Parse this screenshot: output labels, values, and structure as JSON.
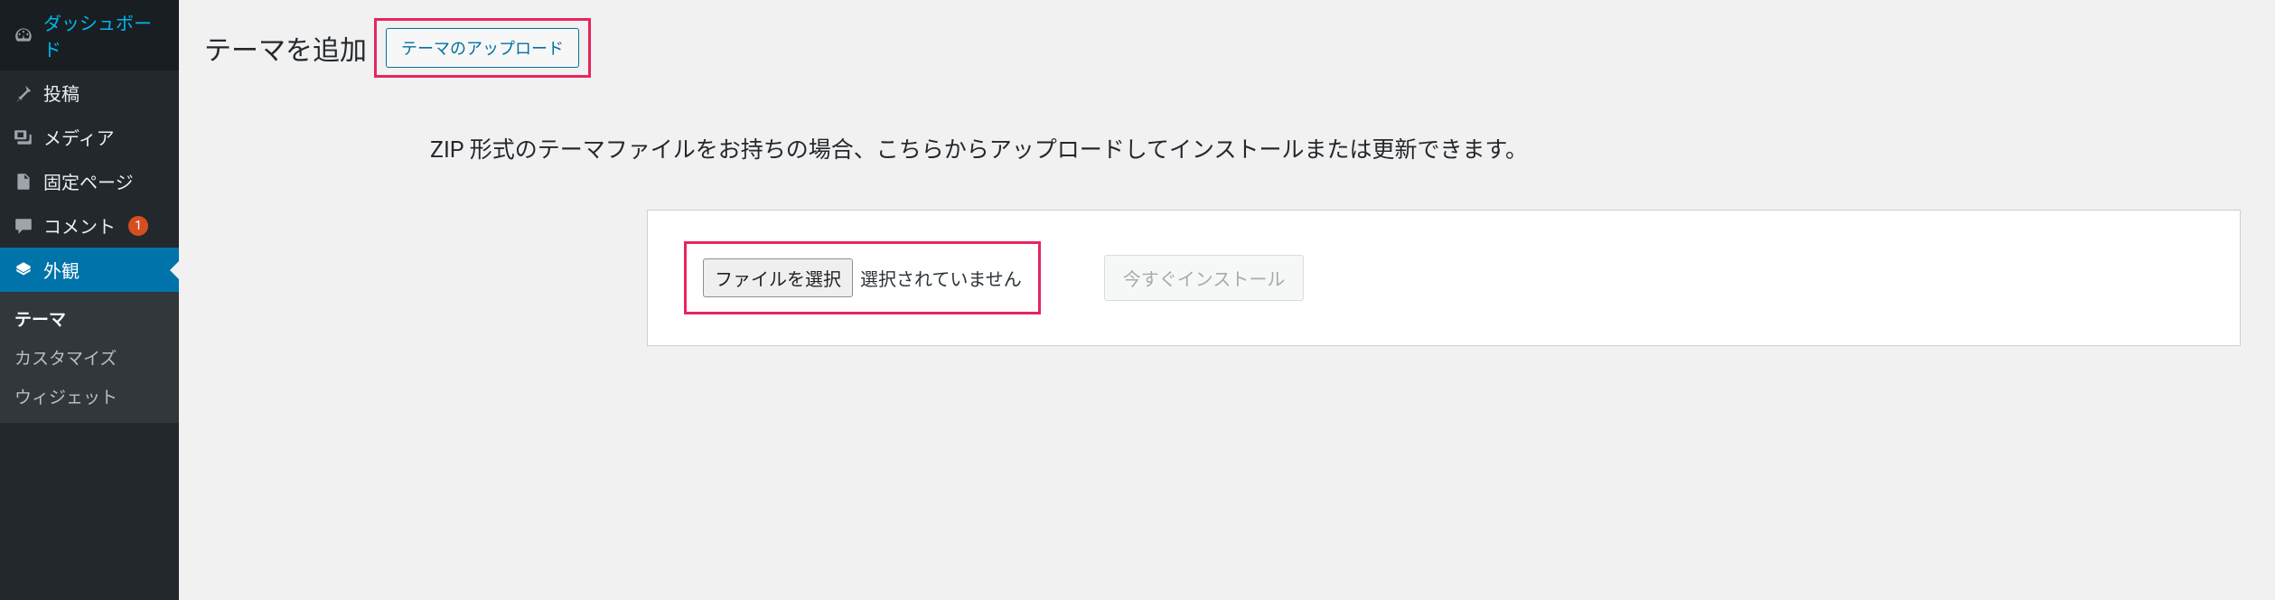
{
  "sidebar": {
    "items": [
      {
        "label": "ダッシュボード",
        "icon": "dashboard"
      },
      {
        "label": "投稿",
        "icon": "pin"
      },
      {
        "label": "メディア",
        "icon": "media"
      },
      {
        "label": "固定ページ",
        "icon": "page"
      },
      {
        "label": "コメント",
        "icon": "comment",
        "badge": "1"
      },
      {
        "label": "外観",
        "icon": "appearance",
        "active": true
      }
    ],
    "submenu": [
      {
        "label": "テーマ",
        "current": true
      },
      {
        "label": "カスタマイズ"
      },
      {
        "label": "ウィジェット"
      }
    ]
  },
  "header": {
    "title": "テーマを追加",
    "upload_button": "テーマのアップロード"
  },
  "upload": {
    "description": "ZIP 形式のテーマファイルをお持ちの場合、こちらからアップロードしてインストールまたは更新できます。",
    "file_button": "ファイルを選択",
    "file_status": "選択されていません",
    "install_button": "今すぐインストール"
  }
}
